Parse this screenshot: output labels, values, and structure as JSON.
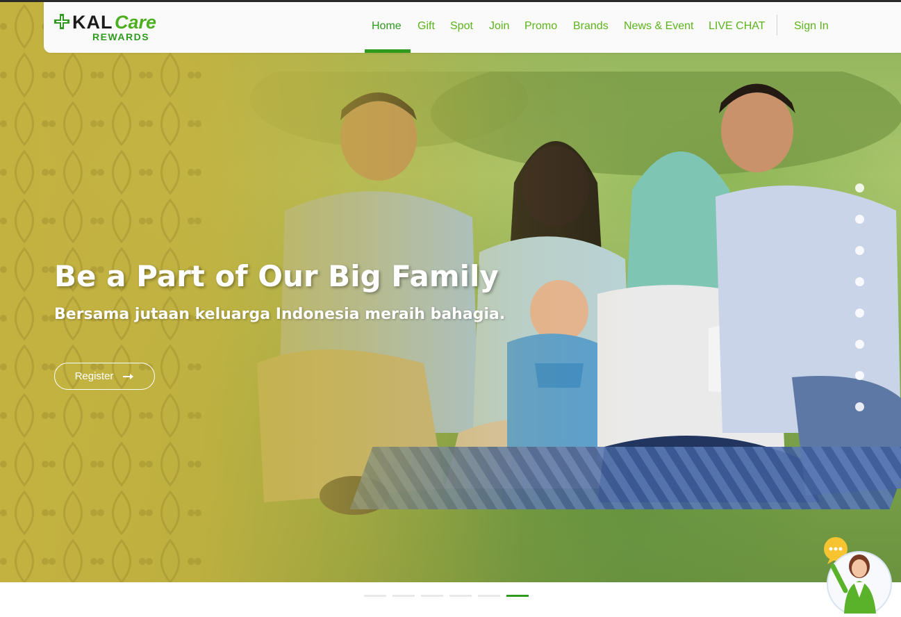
{
  "brand": {
    "name_part1": "KAL",
    "name_part2": "Care",
    "tagline": "REWARDS",
    "green": "#2e9b1f",
    "light_green": "#5bb41a"
  },
  "nav": {
    "items": [
      {
        "label": "Home",
        "active": true
      },
      {
        "label": "Gift",
        "active": false
      },
      {
        "label": "Spot",
        "active": false
      },
      {
        "label": "Join",
        "active": false
      },
      {
        "label": "Promo",
        "active": false
      },
      {
        "label": "Brands",
        "active": false
      },
      {
        "label": "News & Event",
        "active": false
      },
      {
        "label": "LIVE CHAT",
        "active": false
      }
    ],
    "sign_in": "Sign In"
  },
  "hero": {
    "title": "Be a Part of Our Big Family",
    "subtitle": "Bersama jutaan keluarga Indonesia meraih bahagia.",
    "button_label": "Register",
    "button_icon": "arrow-right-icon",
    "overlay_color": "#c4b240"
  },
  "section_dots": {
    "count": 8,
    "active_index": 0
  },
  "slider_dots": {
    "count": 6,
    "active_index": 5
  },
  "chat_widget": {
    "icon": "chat-bubble-icon",
    "avatar": "support-agent-avatar"
  }
}
